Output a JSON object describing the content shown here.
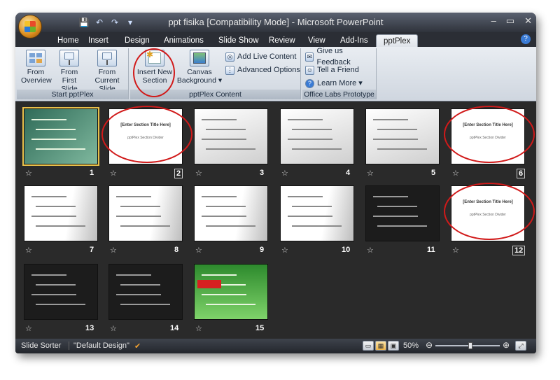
{
  "window": {
    "title_doc": "ppt fisika [Compatibility Mode]",
    "title_sep": " - ",
    "title_app": "Microsoft PowerPoint",
    "controls": [
      "–",
      "▭",
      "✕"
    ]
  },
  "qat": {
    "save": "💾",
    "undo": "↶",
    "redo": "↷",
    "customize": "▾"
  },
  "tabs": [
    "Home",
    "Insert",
    "Design",
    "Animations",
    "Slide Show",
    "Review",
    "View",
    "Add-Ins",
    "pptPlex"
  ],
  "active_tab": "pptPlex",
  "ribbon": {
    "start_group": {
      "label": "Start pptPlex",
      "buttons": [
        {
          "line1": "From",
          "line2": "Overview"
        },
        {
          "line1": "From",
          "line2": "First Slide"
        },
        {
          "line1": "From",
          "line2": "Current Slide"
        }
      ]
    },
    "content_group": {
      "label": "pptPlex Content",
      "insert": {
        "line1": "Insert New",
        "line2": "Section"
      },
      "canvas": {
        "line1": "Canvas",
        "line2": "Background ▾"
      },
      "add_live": "Add Live Content",
      "advanced": "Advanced Options"
    },
    "labs_group": {
      "label": "Office Labs Prototype",
      "feedback": "Give us Feedback",
      "tell": "Tell a Friend",
      "learn": "Learn More ▾"
    }
  },
  "slides": [
    {
      "num": "1",
      "kind": "green"
    },
    {
      "num": "2",
      "kind": "section"
    },
    {
      "num": "3",
      "kind": "paper"
    },
    {
      "num": "4",
      "kind": "paper"
    },
    {
      "num": "5",
      "kind": "paper"
    },
    {
      "num": "6",
      "kind": "section"
    },
    {
      "num": "7",
      "kind": "white3d"
    },
    {
      "num": "8",
      "kind": "white3d"
    },
    {
      "num": "9",
      "kind": "white3d"
    },
    {
      "num": "10",
      "kind": "white3d"
    },
    {
      "num": "11",
      "kind": "dark"
    },
    {
      "num": "12",
      "kind": "section"
    },
    {
      "num": "13",
      "kind": "dark"
    },
    {
      "num": "14",
      "kind": "dark"
    },
    {
      "num": "15",
      "kind": "green2"
    }
  ],
  "section_title": "[Enter Section Title Here]",
  "section_sub": "pptPlex Section Divider",
  "status": {
    "view": "Slide Sorter",
    "theme": "\"Default Design\"",
    "zoom": "50%",
    "zoom_fraction": 0.55
  },
  "colors": {
    "accent": "#d11a1a",
    "selection": "#e8c04a"
  }
}
